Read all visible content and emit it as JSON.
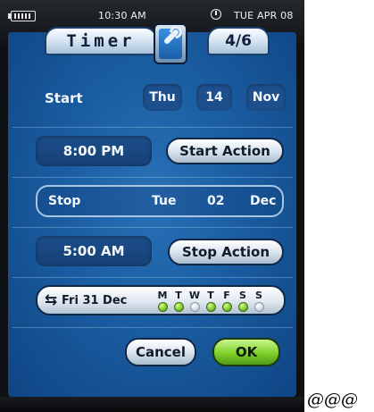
{
  "status": {
    "time": "10:30 AM",
    "date": "TUE APR 08"
  },
  "header": {
    "title": "Timer",
    "page": "4/6"
  },
  "icons": {
    "battery": "battery-icon",
    "clock": "clock-icon",
    "tool": "wrench-icon",
    "repeat": "repeat-icon"
  },
  "start": {
    "label": "Start",
    "day": "Thu",
    "date": "14",
    "month": "Nov",
    "time": "8:00 PM",
    "action_label": "Start Action"
  },
  "stop": {
    "label": "Stop",
    "day": "Tue",
    "date": "02",
    "month": "Dec",
    "time": "5:00 AM",
    "action_label": "Stop Action"
  },
  "repeat": {
    "text": "Fri 31 Dec",
    "days": [
      {
        "letter": "M",
        "on": true
      },
      {
        "letter": "T",
        "on": true
      },
      {
        "letter": "W",
        "on": false
      },
      {
        "letter": "T",
        "on": true
      },
      {
        "letter": "F",
        "on": true
      },
      {
        "letter": "S",
        "on": true
      },
      {
        "letter": "S",
        "on": false
      }
    ]
  },
  "buttons": {
    "cancel": "Cancel",
    "ok": "OK"
  },
  "trailing_text": "@@@",
  "colors": {
    "screen": "#1a5da1",
    "ok": "#7fd12a",
    "bezel": "#0e1014"
  }
}
